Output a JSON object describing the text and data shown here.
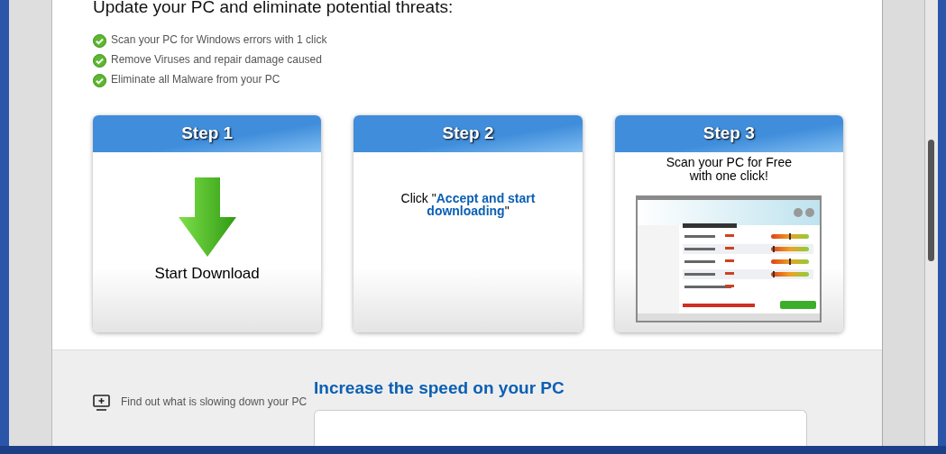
{
  "heading": "Update your PC and eliminate potential threats:",
  "benefits": [
    "Scan your PC for Windows errors with 1 click",
    "Remove Viruses and repair damage caused",
    "Eliminate all Malware from your PC"
  ],
  "steps": [
    {
      "kind": "download",
      "title": "Step 1",
      "caption": "Start Download"
    },
    {
      "kind": "instruction",
      "title": "Step 2",
      "text": "Click \"**Accept and start downloading**\""
    },
    {
      "kind": "scan",
      "title": "Step 3",
      "text": "Scan your PC for Free with one click!"
    }
  ],
  "speed_section": {
    "features": [
      "Find out what is slowing down your PC"
    ],
    "title": "Increase the speed on your PC"
  }
}
